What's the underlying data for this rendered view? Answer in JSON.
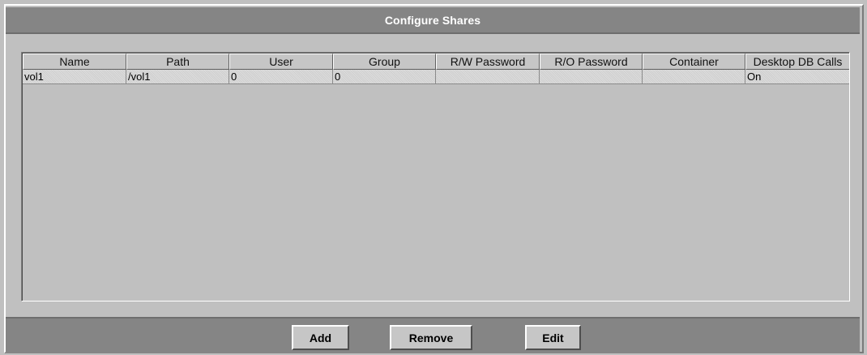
{
  "window": {
    "title": "Configure Shares"
  },
  "table": {
    "columns": [
      "Name",
      "Path",
      "User",
      "Group",
      "R/W Password",
      "R/O Password",
      "Container",
      "Desktop DB Calls"
    ],
    "rows": [
      [
        "vol1",
        "/vol1",
        "0",
        "0",
        "",
        "",
        "",
        "On"
      ]
    ]
  },
  "buttons": {
    "add": "Add",
    "remove": "Remove",
    "edit": "Edit"
  },
  "colors": {
    "title_bar": "#858585",
    "panel_bg": "#c0c0c0",
    "title_text": "#ffffff"
  }
}
